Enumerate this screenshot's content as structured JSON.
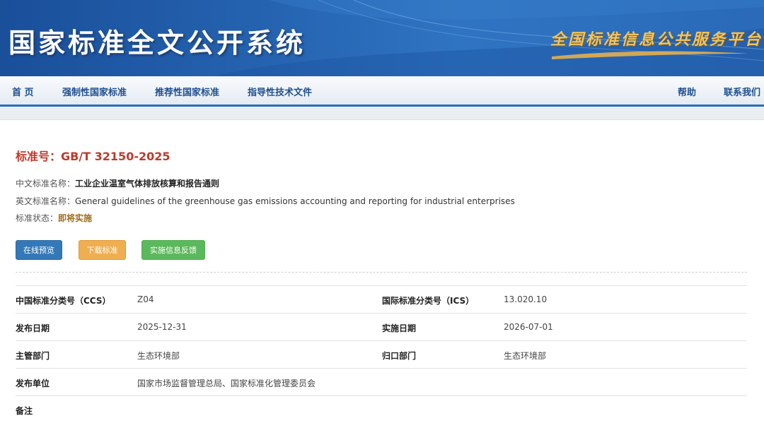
{
  "banner": {
    "title": "国家标准全文公开系统",
    "slogan": "全国标准信息公共服务平台"
  },
  "nav": {
    "items": [
      "首 页",
      "强制性国家标准",
      "推荐性国家标准",
      "指导性技术文件"
    ],
    "right": [
      "帮助",
      "联系我们"
    ]
  },
  "standard": {
    "number": "标准号：GB/T 32150-2025",
    "cn_name_label": "中文标准名称：",
    "cn_name": "工业企业温室气体排放核算和报告通则",
    "en_name_label": "英文标准名称：",
    "en_name": "General guidelines of the greenhouse gas emissions accounting and reporting for industrial enterprises",
    "status_label": "标准状态：",
    "status": "即将实施"
  },
  "buttons": {
    "preview": "在线预览",
    "download": "下载标准",
    "feedback": "实施信息反馈"
  },
  "details": {
    "ccs_label": "中国标准分类号（CCS）",
    "ccs": "Z04",
    "ics_label": "国际标准分类号（ICS）",
    "ics": "13.020.10",
    "publish_date_label": "发布日期",
    "publish_date": "2025-12-31",
    "implement_date_label": "实施日期",
    "implement_date": "2026-07-01",
    "dept_label": "主管部门",
    "dept": "生态环境部",
    "centralized_label": "归口部门",
    "centralized": "生态环境部",
    "issuer_label": "发布单位",
    "issuer": "国家市场监督管理总局、国家标准化管理委员会",
    "remark_label": "备注",
    "remark": ""
  },
  "colors": {
    "banner": "#2563b0",
    "nav_text": "#1f4f8f",
    "std_no": "#c0392b",
    "status": "#a06b1a",
    "btn_blue": "#3479b7",
    "btn_orange": "#efae4f",
    "btn_green": "#5cb85c"
  }
}
